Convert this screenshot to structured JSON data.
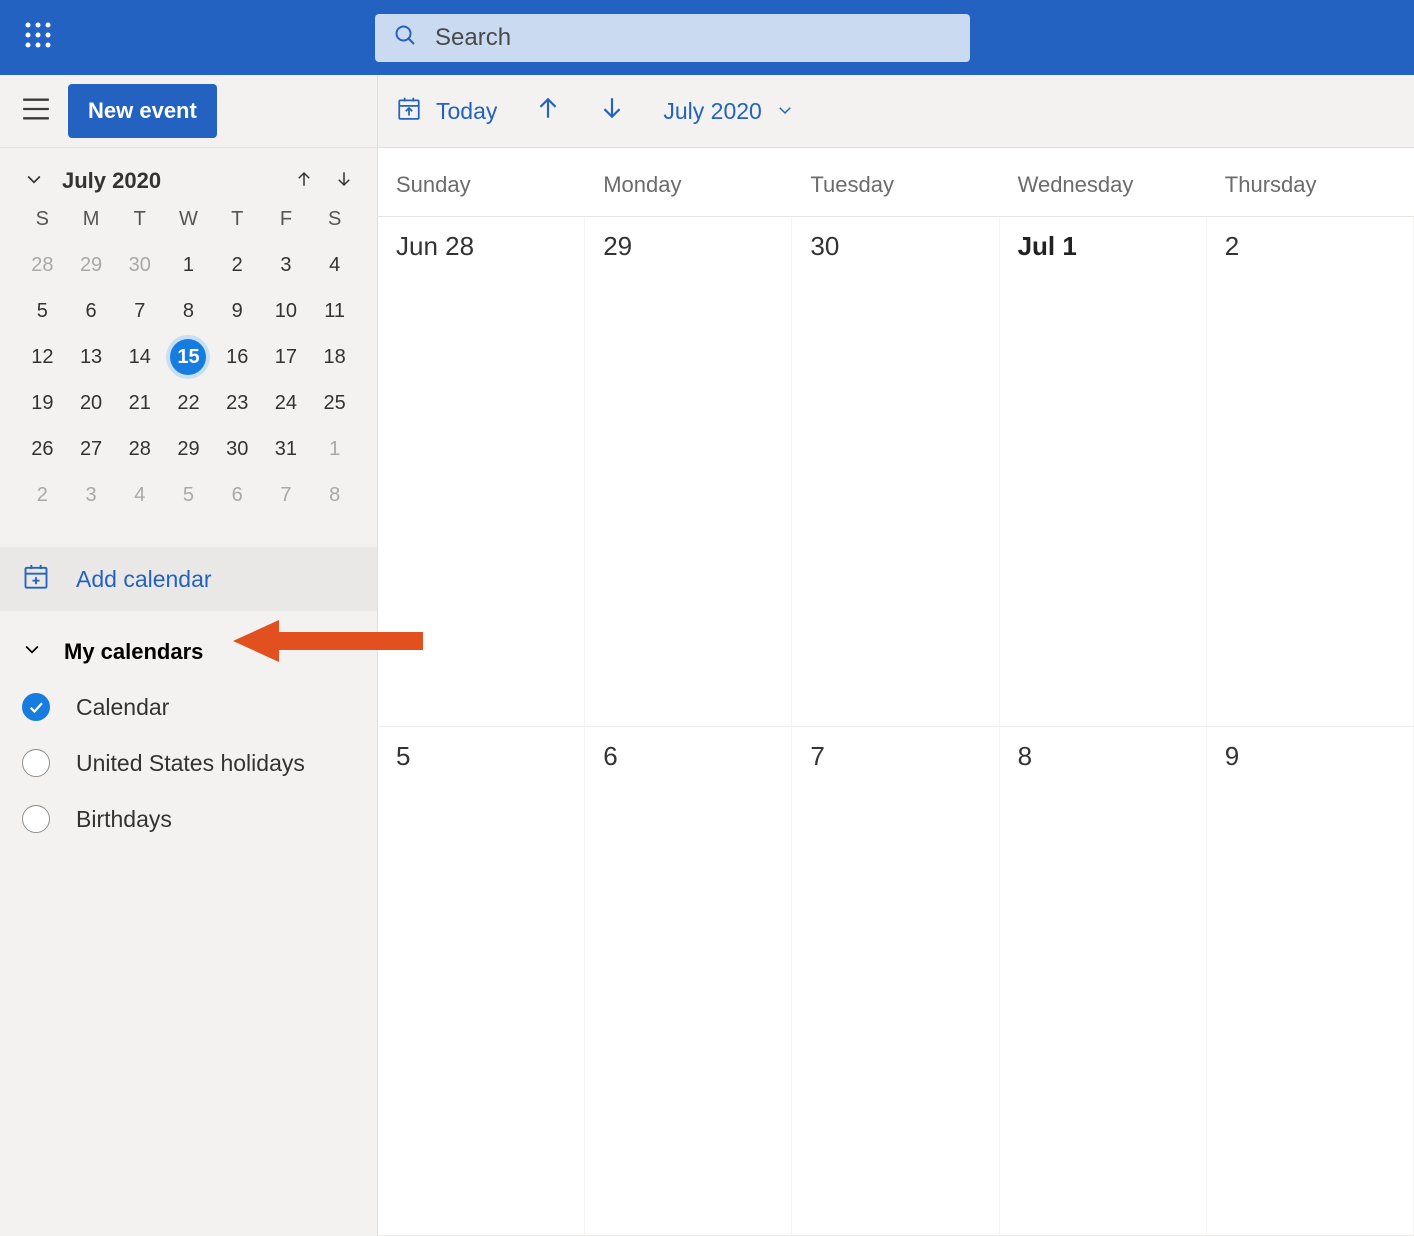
{
  "search": {
    "placeholder": "Search"
  },
  "sidebar": {
    "new_label": "New event",
    "minical": {
      "title": "July 2020",
      "dow": [
        "S",
        "M",
        "T",
        "W",
        "T",
        "F",
        "S"
      ],
      "rows": [
        [
          {
            "n": "28",
            "o": true
          },
          {
            "n": "29",
            "o": true
          },
          {
            "n": "30",
            "o": true
          },
          {
            "n": "1"
          },
          {
            "n": "2"
          },
          {
            "n": "3"
          },
          {
            "n": "4"
          }
        ],
        [
          {
            "n": "5"
          },
          {
            "n": "6"
          },
          {
            "n": "7"
          },
          {
            "n": "8"
          },
          {
            "n": "9"
          },
          {
            "n": "10"
          },
          {
            "n": "11"
          }
        ],
        [
          {
            "n": "12"
          },
          {
            "n": "13"
          },
          {
            "n": "14"
          },
          {
            "n": "15",
            "sel": true
          },
          {
            "n": "16"
          },
          {
            "n": "17"
          },
          {
            "n": "18"
          }
        ],
        [
          {
            "n": "19"
          },
          {
            "n": "20"
          },
          {
            "n": "21"
          },
          {
            "n": "22"
          },
          {
            "n": "23"
          },
          {
            "n": "24"
          },
          {
            "n": "25"
          }
        ],
        [
          {
            "n": "26"
          },
          {
            "n": "27"
          },
          {
            "n": "28"
          },
          {
            "n": "29"
          },
          {
            "n": "30"
          },
          {
            "n": "31"
          },
          {
            "n": "1",
            "o": true
          }
        ],
        [
          {
            "n": "2",
            "o": true
          },
          {
            "n": "3",
            "o": true
          },
          {
            "n": "4",
            "o": true
          },
          {
            "n": "5",
            "o": true
          },
          {
            "n": "6",
            "o": true
          },
          {
            "n": "7",
            "o": true
          },
          {
            "n": "8",
            "o": true
          }
        ]
      ]
    },
    "add_calendar_label": "Add calendar",
    "my_calendars_label": "My calendars",
    "calendars": [
      {
        "name": "Calendar",
        "checked": true
      },
      {
        "name": "United States holidays",
        "checked": false
      },
      {
        "name": "Birthdays",
        "checked": false
      }
    ]
  },
  "toolbar": {
    "today_label": "Today",
    "month_label": "July 2020"
  },
  "grid": {
    "headers": [
      "Sunday",
      "Monday",
      "Tuesday",
      "Wednesday",
      "Thursday"
    ],
    "weeks": [
      [
        {
          "t": "Jun 28"
        },
        {
          "t": "29"
        },
        {
          "t": "30"
        },
        {
          "t": "Jul 1",
          "bold": true
        },
        {
          "t": "2"
        }
      ],
      [
        {
          "t": "5"
        },
        {
          "t": "6"
        },
        {
          "t": "7"
        },
        {
          "t": "8"
        },
        {
          "t": "9"
        }
      ]
    ]
  },
  "annotation": {
    "arrow_color": "#e1501e"
  }
}
